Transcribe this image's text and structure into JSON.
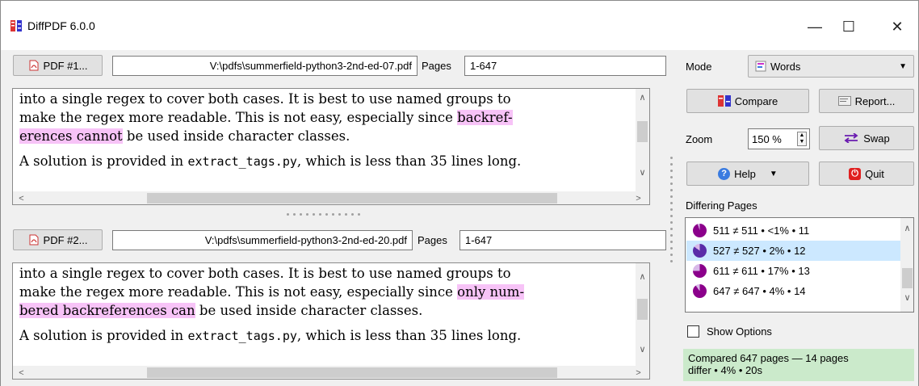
{
  "window": {
    "title": "DiffPDF 6.0.0",
    "minimize": "—",
    "maximize": "☐",
    "close": "✕"
  },
  "pdf1": {
    "button_label": "PDF #1...",
    "path": "V:\\pdfs\\summerfield-python3-2nd-ed-07.pdf",
    "pages_label": "Pages",
    "pages_value": "1-647",
    "text": {
      "line1": "into a single regex to cover both cases.  It is best to use named groups to",
      "line2_pre": "make the regex more readable.  This is not easy, especially since ",
      "line2_hl": "backref-",
      "line3_hl": "erences cannot",
      "line3_post": " be used inside character classes.",
      "line4_pre": "A solution is provided in ",
      "line4_code": "extract_tags.py",
      "line4_post": ", which is less than 35 lines long."
    }
  },
  "pdf2": {
    "button_label": "PDF #2...",
    "path": "V:\\pdfs\\summerfield-python3-2nd-ed-20.pdf",
    "pages_label": "Pages",
    "pages_value": "1-647",
    "text": {
      "line1": "into a single regex to cover both cases.  It is best to use named groups to",
      "line2_pre": "make the regex more readable.  This is not easy, especially since ",
      "line2_hl": "only num-",
      "line3_hl": "bered backreferences can",
      "line3_post": " be used inside character classes.",
      "line4_pre": "A solution is provided in ",
      "line4_code": "extract_tags.py",
      "line4_post": ", which is less than 35 lines long."
    }
  },
  "controls": {
    "mode_label": "Mode",
    "mode_value": "Words",
    "compare_label": "Compare",
    "report_label": "Report...",
    "zoom_label": "Zoom",
    "zoom_value": "150 %",
    "swap_label": "Swap",
    "help_label": "Help",
    "quit_label": "Quit",
    "differing_pages_label": "Differing Pages",
    "show_options_label": "Show Options"
  },
  "differing_pages": [
    {
      "text": "511 ≠ 511 • <1% • 11",
      "color": "#8b008b",
      "selected": false
    },
    {
      "text": "527 ≠ 527 • 2% • 12",
      "color": "#5a2ca8",
      "selected": true
    },
    {
      "text": "611 ≠ 611 • 17% • 13",
      "color": "#8b008b",
      "selected": false
    },
    {
      "text": "647 ≠ 647 • 4% • 14",
      "color": "#8b008b",
      "selected": false
    }
  ],
  "status": {
    "line1": "Compared 647 pages — 14 pages",
    "line2": "differ • 4% • 20s"
  },
  "colors": {
    "highlight": "#f7c3f7",
    "status_bg": "#cbeacb",
    "selection": "#cce8ff"
  }
}
